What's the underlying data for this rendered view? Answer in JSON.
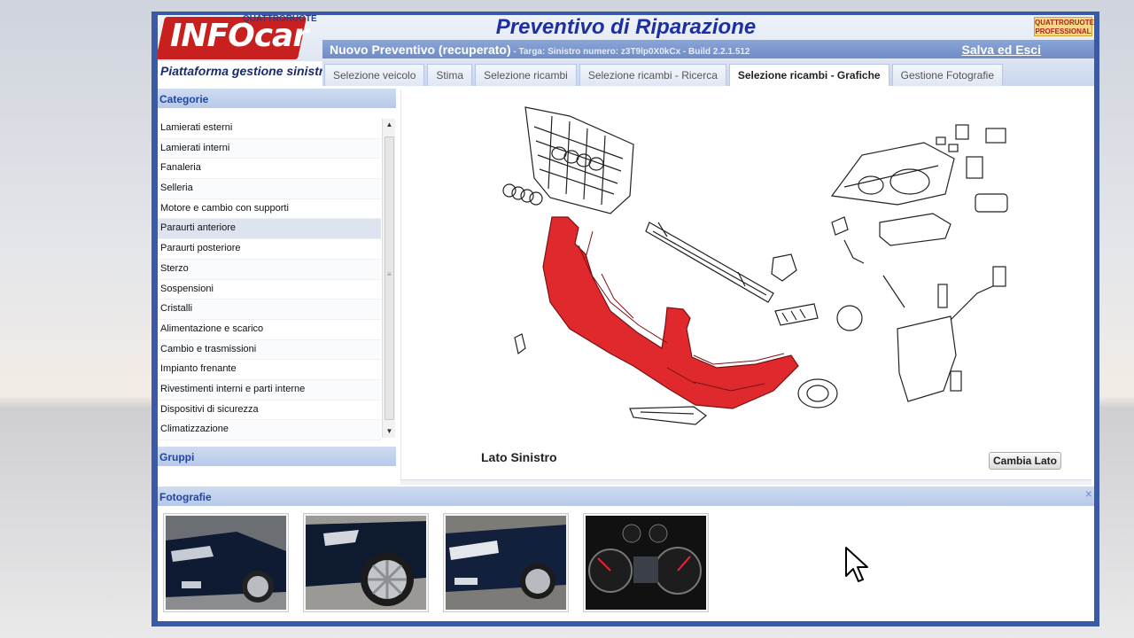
{
  "header": {
    "logo_text": "INFOcar",
    "logo_subtext": "QUATTRORUOTE",
    "title": "Preventivo di Riparazione",
    "brand_right": "QUATTRORUOTE PROFESSIONAL",
    "info_main": "Nuovo Preventivo (recuperato)",
    "info_detail": " - Targa:   Sinistro numero: z3T9lp0X0kCx - Build 2.2.1.512",
    "save_exit": "Salva ed Esci",
    "subtitle": "Piattaforma gestione sinistri"
  },
  "tabs": [
    {
      "label": "Selezione veicolo"
    },
    {
      "label": "Stima"
    },
    {
      "label": "Selezione ricambi"
    },
    {
      "label": "Selezione ricambi - Ricerca"
    },
    {
      "label": "Selezione ricambi - Grafiche"
    },
    {
      "label": "Gestione Fotografie"
    }
  ],
  "active_tab": "Selezione ricambi - Grafiche",
  "sidebar": {
    "categories_title": "Categorie",
    "groups_title": "Gruppi",
    "items": [
      {
        "label": "Lamierati esterni"
      },
      {
        "label": "Lamierati interni"
      },
      {
        "label": "Fanaleria"
      },
      {
        "label": "Selleria"
      },
      {
        "label": "Motore e cambio con supporti"
      },
      {
        "label": "Paraurti anteriore"
      },
      {
        "label": "Paraurti posteriore"
      },
      {
        "label": "Sterzo"
      },
      {
        "label": "Sospensioni"
      },
      {
        "label": "Cristalli"
      },
      {
        "label": "Alimentazione e scarico"
      },
      {
        "label": "Cambio e trasmissioni"
      },
      {
        "label": "Impianto frenante"
      },
      {
        "label": "Rivestimenti interni e parti interne"
      },
      {
        "label": "Dispositivi di sicurezza"
      },
      {
        "label": "Climatizzazione"
      }
    ],
    "selected": "Paraurti anteriore"
  },
  "diagram": {
    "side_label": "Lato Sinistro",
    "change_side_button": "Cambia Lato",
    "highlight_color": "#e0292c"
  },
  "photos": {
    "title": "Fotografie",
    "items": [
      {
        "icon": "car-front-left-photo"
      },
      {
        "icon": "car-wheel-photo"
      },
      {
        "icon": "car-headlight-photo"
      },
      {
        "icon": "dashboard-photo"
      }
    ]
  },
  "colors": {
    "frame": "#3a5aa8",
    "header_text": "#1d2fa3",
    "logo_red": "#c8201e"
  }
}
